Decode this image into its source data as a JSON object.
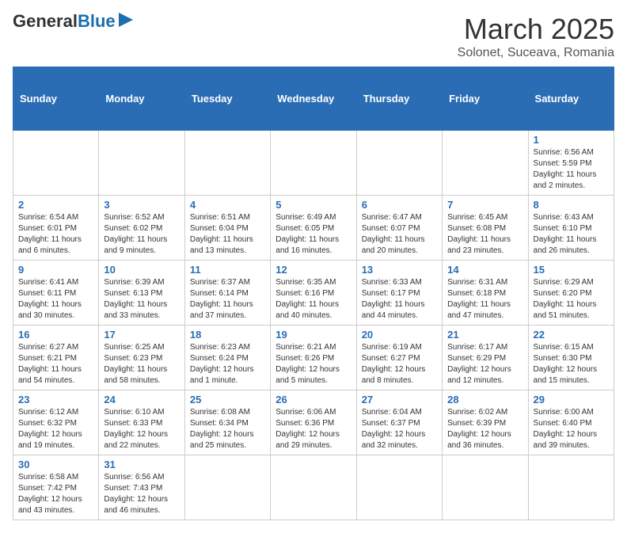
{
  "header": {
    "logo_general": "General",
    "logo_blue": "Blue",
    "title": "March 2025",
    "subtitle": "Solonet, Suceava, Romania"
  },
  "weekdays": [
    "Sunday",
    "Monday",
    "Tuesday",
    "Wednesday",
    "Thursday",
    "Friday",
    "Saturday"
  ],
  "weeks": [
    [
      {
        "day": null
      },
      {
        "day": null
      },
      {
        "day": null
      },
      {
        "day": null
      },
      {
        "day": null
      },
      {
        "day": null
      },
      {
        "day": "1",
        "info": "Sunrise: 6:56 AM\nSunset: 5:59 PM\nDaylight: 11 hours and 2 minutes."
      }
    ],
    [
      {
        "day": "2",
        "info": "Sunrise: 6:54 AM\nSunset: 6:01 PM\nDaylight: 11 hours and 6 minutes."
      },
      {
        "day": "3",
        "info": "Sunrise: 6:52 AM\nSunset: 6:02 PM\nDaylight: 11 hours and 9 minutes."
      },
      {
        "day": "4",
        "info": "Sunrise: 6:51 AM\nSunset: 6:04 PM\nDaylight: 11 hours and 13 minutes."
      },
      {
        "day": "5",
        "info": "Sunrise: 6:49 AM\nSunset: 6:05 PM\nDaylight: 11 hours and 16 minutes."
      },
      {
        "day": "6",
        "info": "Sunrise: 6:47 AM\nSunset: 6:07 PM\nDaylight: 11 hours and 20 minutes."
      },
      {
        "day": "7",
        "info": "Sunrise: 6:45 AM\nSunset: 6:08 PM\nDaylight: 11 hours and 23 minutes."
      },
      {
        "day": "8",
        "info": "Sunrise: 6:43 AM\nSunset: 6:10 PM\nDaylight: 11 hours and 26 minutes."
      }
    ],
    [
      {
        "day": "9",
        "info": "Sunrise: 6:41 AM\nSunset: 6:11 PM\nDaylight: 11 hours and 30 minutes."
      },
      {
        "day": "10",
        "info": "Sunrise: 6:39 AM\nSunset: 6:13 PM\nDaylight: 11 hours and 33 minutes."
      },
      {
        "day": "11",
        "info": "Sunrise: 6:37 AM\nSunset: 6:14 PM\nDaylight: 11 hours and 37 minutes."
      },
      {
        "day": "12",
        "info": "Sunrise: 6:35 AM\nSunset: 6:16 PM\nDaylight: 11 hours and 40 minutes."
      },
      {
        "day": "13",
        "info": "Sunrise: 6:33 AM\nSunset: 6:17 PM\nDaylight: 11 hours and 44 minutes."
      },
      {
        "day": "14",
        "info": "Sunrise: 6:31 AM\nSunset: 6:18 PM\nDaylight: 11 hours and 47 minutes."
      },
      {
        "day": "15",
        "info": "Sunrise: 6:29 AM\nSunset: 6:20 PM\nDaylight: 11 hours and 51 minutes."
      }
    ],
    [
      {
        "day": "16",
        "info": "Sunrise: 6:27 AM\nSunset: 6:21 PM\nDaylight: 11 hours and 54 minutes."
      },
      {
        "day": "17",
        "info": "Sunrise: 6:25 AM\nSunset: 6:23 PM\nDaylight: 11 hours and 58 minutes."
      },
      {
        "day": "18",
        "info": "Sunrise: 6:23 AM\nSunset: 6:24 PM\nDaylight: 12 hours and 1 minute."
      },
      {
        "day": "19",
        "info": "Sunrise: 6:21 AM\nSunset: 6:26 PM\nDaylight: 12 hours and 5 minutes."
      },
      {
        "day": "20",
        "info": "Sunrise: 6:19 AM\nSunset: 6:27 PM\nDaylight: 12 hours and 8 minutes."
      },
      {
        "day": "21",
        "info": "Sunrise: 6:17 AM\nSunset: 6:29 PM\nDaylight: 12 hours and 12 minutes."
      },
      {
        "day": "22",
        "info": "Sunrise: 6:15 AM\nSunset: 6:30 PM\nDaylight: 12 hours and 15 minutes."
      }
    ],
    [
      {
        "day": "23",
        "info": "Sunrise: 6:12 AM\nSunset: 6:32 PM\nDaylight: 12 hours and 19 minutes."
      },
      {
        "day": "24",
        "info": "Sunrise: 6:10 AM\nSunset: 6:33 PM\nDaylight: 12 hours and 22 minutes."
      },
      {
        "day": "25",
        "info": "Sunrise: 6:08 AM\nSunset: 6:34 PM\nDaylight: 12 hours and 25 minutes."
      },
      {
        "day": "26",
        "info": "Sunrise: 6:06 AM\nSunset: 6:36 PM\nDaylight: 12 hours and 29 minutes."
      },
      {
        "day": "27",
        "info": "Sunrise: 6:04 AM\nSunset: 6:37 PM\nDaylight: 12 hours and 32 minutes."
      },
      {
        "day": "28",
        "info": "Sunrise: 6:02 AM\nSunset: 6:39 PM\nDaylight: 12 hours and 36 minutes."
      },
      {
        "day": "29",
        "info": "Sunrise: 6:00 AM\nSunset: 6:40 PM\nDaylight: 12 hours and 39 minutes."
      }
    ],
    [
      {
        "day": "30",
        "info": "Sunrise: 6:58 AM\nSunset: 7:42 PM\nDaylight: 12 hours and 43 minutes."
      },
      {
        "day": "31",
        "info": "Sunrise: 6:56 AM\nSunset: 7:43 PM\nDaylight: 12 hours and 46 minutes."
      },
      {
        "day": null
      },
      {
        "day": null
      },
      {
        "day": null
      },
      {
        "day": null
      },
      {
        "day": null
      }
    ]
  ]
}
